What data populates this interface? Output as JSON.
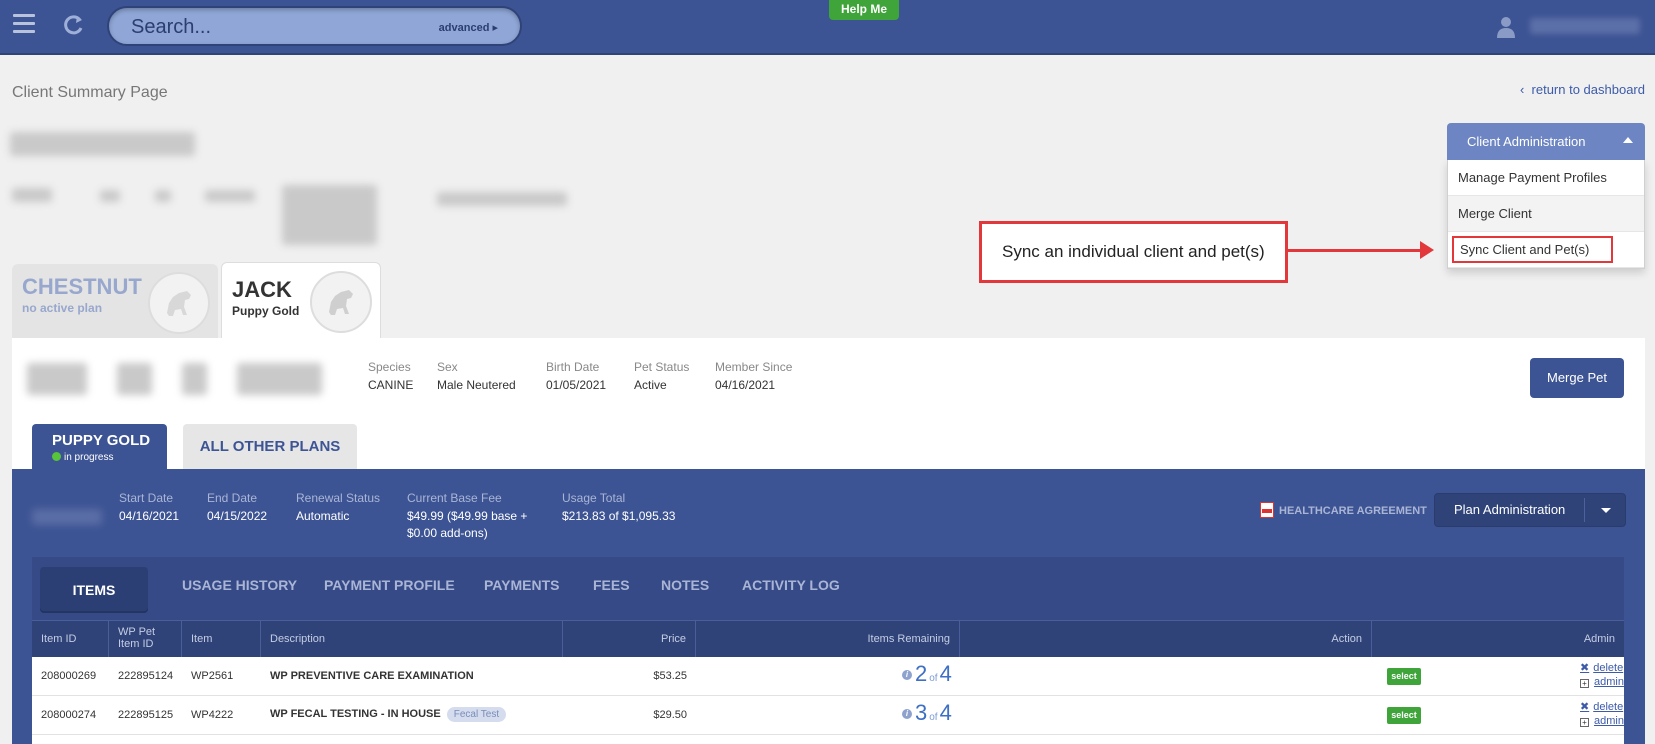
{
  "topbar": {
    "search_placeholder": "Search...",
    "advanced_label": "advanced",
    "help_label": "Help Me"
  },
  "page": {
    "title": "Client Summary Page",
    "return_link": "return to dashboard"
  },
  "client_admin": {
    "header": "Client Administration",
    "items": [
      {
        "label": "Manage Payment Profiles"
      },
      {
        "label": "Merge Client"
      },
      {
        "label": "Sync Client and Pet(s)"
      }
    ]
  },
  "callout": {
    "text": "Sync an individual client and pet(s)"
  },
  "pets": [
    {
      "name": "CHESTNUT",
      "plan": "no active plan"
    },
    {
      "name": "JACK",
      "plan": "Puppy Gold"
    }
  ],
  "pet_info": {
    "species_label": "Species",
    "species": "CANINE",
    "sex_label": "Sex",
    "sex": "Male Neutered",
    "birth_label": "Birth Date",
    "birth": "01/05/2021",
    "status_label": "Pet Status",
    "status": "Active",
    "member_label": "Member Since",
    "member": "04/16/2021",
    "merge_button": "Merge Pet"
  },
  "plan_tabs": {
    "active_name": "PUPPY GOLD",
    "active_status": "in progress",
    "other": "ALL OTHER PLANS"
  },
  "plan": {
    "start_label": "Start Date",
    "start": "04/16/2021",
    "end_label": "End Date",
    "end": "04/15/2022",
    "renewal_label": "Renewal Status",
    "renewal": "Automatic",
    "fee_label": "Current Base Fee",
    "fee_line1": "$49.99 ($49.99 base +",
    "fee_line2": "$0.00 add-ons)",
    "usage_label": "Usage Total",
    "usage": "$213.83 of $1,095.33",
    "agreement": "HEALTHCARE AGREEMENT",
    "admin_button": "Plan Administration"
  },
  "item_tabs": [
    "ITEMS",
    "USAGE HISTORY",
    "PAYMENT PROFILE",
    "PAYMENTS",
    "FEES",
    "NOTES",
    "ACTIVITY LOG"
  ],
  "table": {
    "headers": {
      "item_id": "Item ID",
      "wp_pet_line1": "WP Pet",
      "wp_pet_line2": "Item ID",
      "item": "Item",
      "description": "Description",
      "price": "Price",
      "remaining": "Items Remaining",
      "action": "Action",
      "admin": "Admin"
    },
    "rows": [
      {
        "item_id": "208000269",
        "wp_pet_id": "222895124",
        "item": "WP2561",
        "description": "WP PREVENTIVE CARE EXAMINATION",
        "tag": "",
        "price": "$53.25",
        "remaining": "2",
        "of": "of",
        "total": "4",
        "action": "select",
        "delete": "delete",
        "admin": "admin"
      },
      {
        "item_id": "208000274",
        "wp_pet_id": "222895125",
        "item": "WP4222",
        "description": "WP FECAL TESTING - IN HOUSE",
        "tag": "Fecal Test",
        "price": "$29.50",
        "remaining": "3",
        "of": "of",
        "total": "4",
        "action": "select",
        "delete": "delete",
        "admin": "admin"
      }
    ]
  },
  "colors": {
    "brand": "#3d5494",
    "accent_green": "#3fa43a",
    "callout_red": "#e2383c"
  }
}
